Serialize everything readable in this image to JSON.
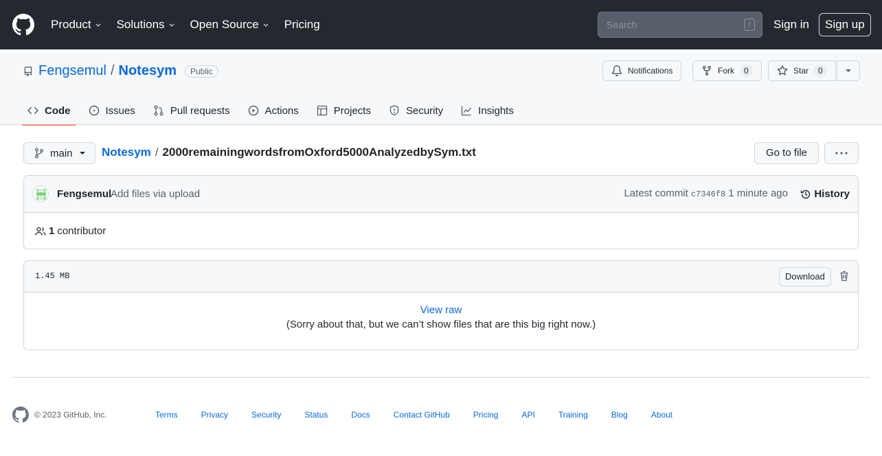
{
  "header": {
    "nav": [
      {
        "label": "Product",
        "has_menu": true
      },
      {
        "label": "Solutions",
        "has_menu": true
      },
      {
        "label": "Open Source",
        "has_menu": true
      },
      {
        "label": "Pricing",
        "has_menu": false
      }
    ],
    "search_placeholder": "Search",
    "search_shortcut": "/",
    "signin": "Sign in",
    "signup": "Sign up"
  },
  "repo": {
    "owner": "Fengsemul",
    "separator": "/",
    "name": "Notesym",
    "visibility": "Public",
    "actions": {
      "notifications": "Notifications",
      "fork": "Fork",
      "fork_count": "0",
      "star": "Star",
      "star_count": "0"
    },
    "tabs": [
      {
        "label": "Code",
        "icon": "code-icon",
        "active": true
      },
      {
        "label": "Issues",
        "icon": "issue-icon",
        "active": false
      },
      {
        "label": "Pull requests",
        "icon": "pull-request-icon",
        "active": false
      },
      {
        "label": "Actions",
        "icon": "play-icon",
        "active": false
      },
      {
        "label": "Projects",
        "icon": "table-icon",
        "active": false
      },
      {
        "label": "Security",
        "icon": "shield-icon",
        "active": false
      },
      {
        "label": "Insights",
        "icon": "graph-icon",
        "active": false
      }
    ]
  },
  "file_nav": {
    "branch": "main",
    "repo_link": "Notesym",
    "separator": "/",
    "filename": "2000remainingwordsfromOxford5000AnalyzedbySym.txt",
    "goto_file": "Go to file"
  },
  "commit": {
    "author": "Fengsemul",
    "message": "Add files via upload",
    "latest_label": "Latest commit",
    "sha": "c7346f8",
    "time": "1 minute ago",
    "history": "History",
    "contributors_count": "1",
    "contributors_label": "contributor"
  },
  "file": {
    "size": "1.45 MB",
    "download": "Download",
    "view_raw": "View raw",
    "too_big_message": "(Sorry about that, but we can’t show files that are this big right now.)"
  },
  "footer": {
    "copyright": "© 2023 GitHub, Inc.",
    "links": [
      "Terms",
      "Privacy",
      "Security",
      "Status",
      "Docs",
      "Contact GitHub",
      "Pricing",
      "API",
      "Training",
      "Blog",
      "About"
    ]
  },
  "colors": {
    "header_bg": "#24292f",
    "link": "#0969da",
    "active_tab_underline": "#fd8c73",
    "border": "#d0d7de",
    "subtle_bg": "#f6f8fa"
  }
}
